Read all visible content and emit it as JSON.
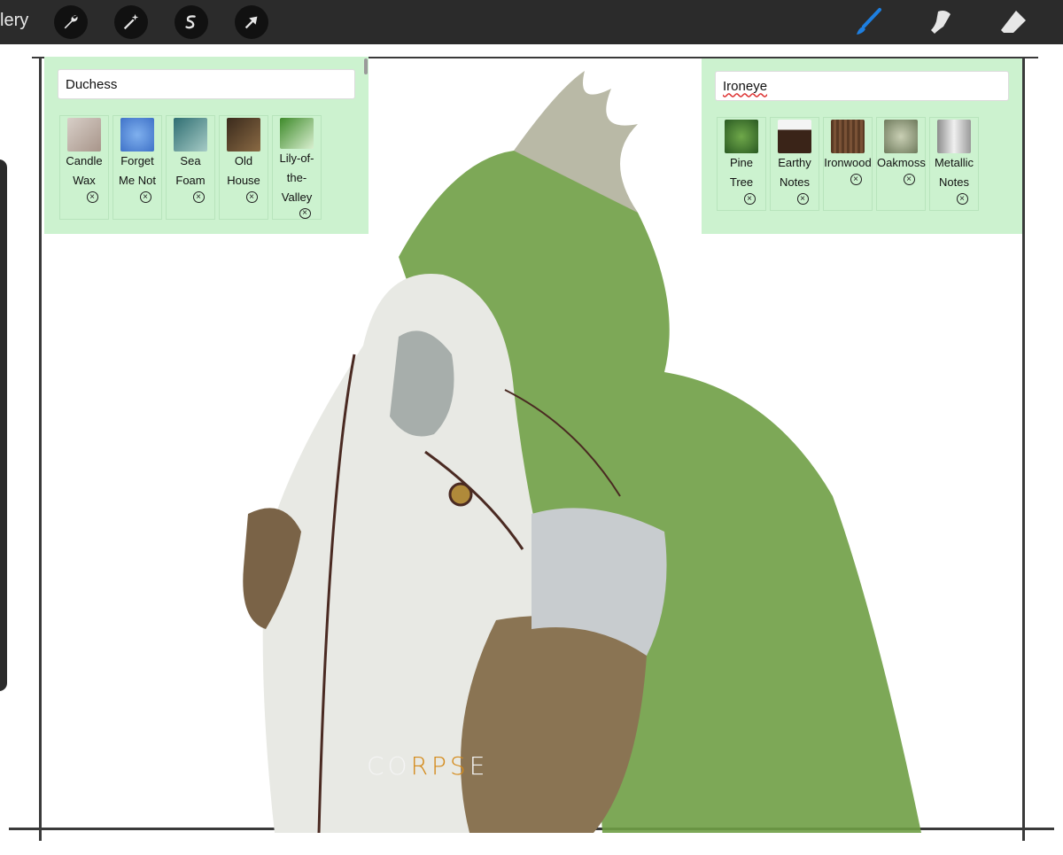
{
  "toolbar": {
    "gallery_label": "lery",
    "tools": [
      "wrench-icon",
      "magic-wand-icon",
      "selection-icon",
      "transform-arrow-icon"
    ],
    "right_tools": [
      "brush-icon",
      "smudge-icon",
      "eraser-icon"
    ],
    "active_color": "#1e7fe0"
  },
  "left_panel": {
    "name": "Duchess",
    "items": [
      {
        "line1": "Candle",
        "line2": "Wax",
        "line3": ""
      },
      {
        "line1": "Forget",
        "line2": "Me Not",
        "line3": ""
      },
      {
        "line1": "Sea",
        "line2": "Foam",
        "line3": ""
      },
      {
        "line1": "Old",
        "line2": "House",
        "line3": ""
      },
      {
        "line1": "Lily-of-",
        "line2": "the-",
        "line3": "Valley"
      }
    ]
  },
  "right_panel": {
    "name": "Ironeye",
    "items": [
      {
        "line1": "Pine",
        "line2": "Tree"
      },
      {
        "line1": "Earthy",
        "line2": "Notes"
      },
      {
        "line1": "Ironwood",
        "line2": ""
      },
      {
        "line1": "Oakmoss",
        "line2": ""
      },
      {
        "line1": "Metallic",
        "line2": "Notes"
      }
    ]
  },
  "watermark": {
    "pre": "CO",
    "accent": "RPS",
    "post": "E"
  },
  "colors": {
    "panel": "#ccf2cf",
    "toolbar": "#2b2b2b"
  }
}
